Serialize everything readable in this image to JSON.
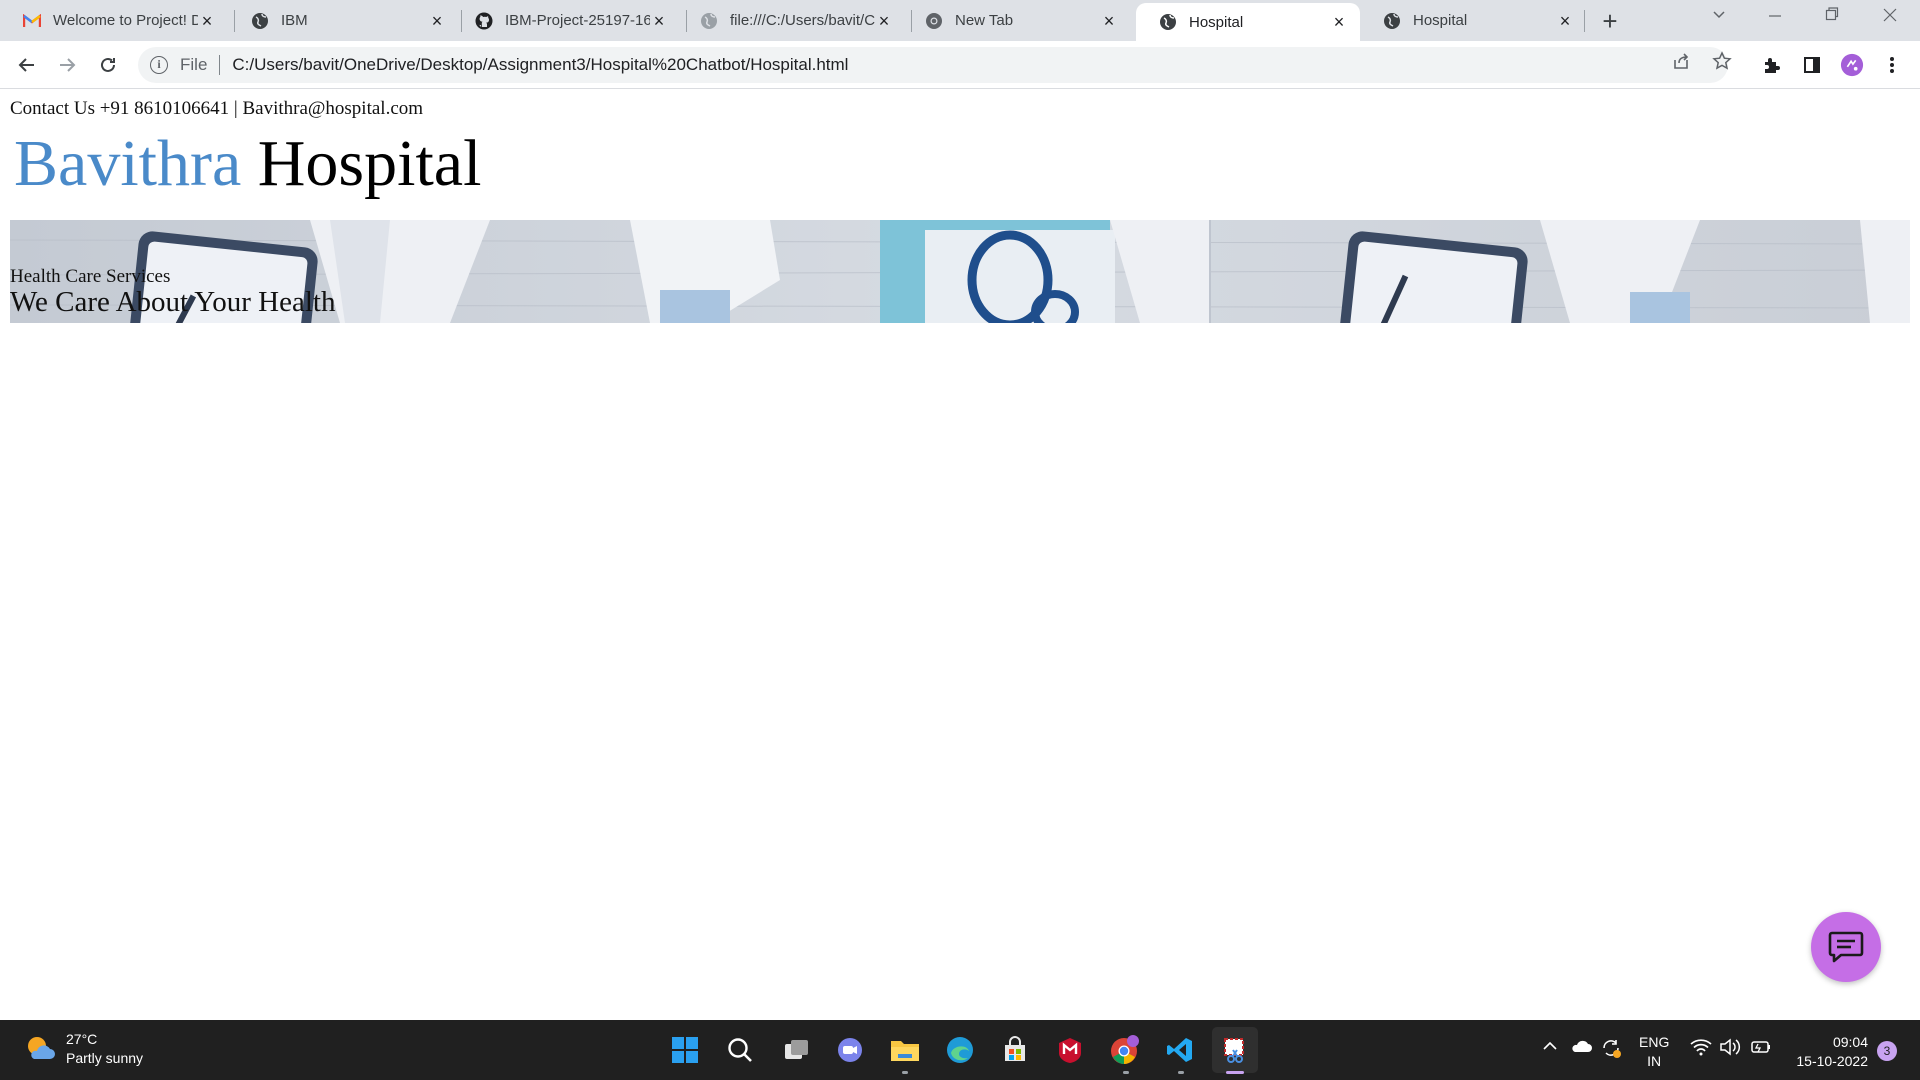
{
  "browser": {
    "tabs": [
      {
        "title": "Welcome to Project! D",
        "icon": "gmail-icon"
      },
      {
        "title": "IBM",
        "icon": "globe-icon"
      },
      {
        "title": "IBM-Project-25197-16",
        "icon": "github-icon"
      },
      {
        "title": "file:///C:/Users/bavit/C",
        "icon": "globe-icon"
      },
      {
        "title": "New Tab",
        "icon": "chrome-icon"
      },
      {
        "title": "Hospital",
        "icon": "globe-icon",
        "active": true
      },
      {
        "title": "Hospital",
        "icon": "globe-icon"
      }
    ],
    "address": {
      "scheme_label": "File",
      "url": "C:/Users/bavit/OneDrive/Desktop/Assignment3/Hospital%20Chatbot/Hospital.html"
    }
  },
  "page": {
    "contact": "Contact Us +91 8610106641 | Bavithra@hospital.com",
    "brand_first": "Bavithra",
    "brand_second": "Hospital",
    "hero_small": "Health Care Services",
    "hero_big": "We Care About Your Health",
    "brand_color": "#4a8ac9",
    "chat_button_color": "#c56ee6"
  },
  "taskbar": {
    "weather_temp": "27°C",
    "weather_desc": "Partly sunny",
    "lang_top": "ENG",
    "lang_bottom": "IN",
    "time": "09:04",
    "date": "15-10-2022",
    "notification_count": "3"
  }
}
